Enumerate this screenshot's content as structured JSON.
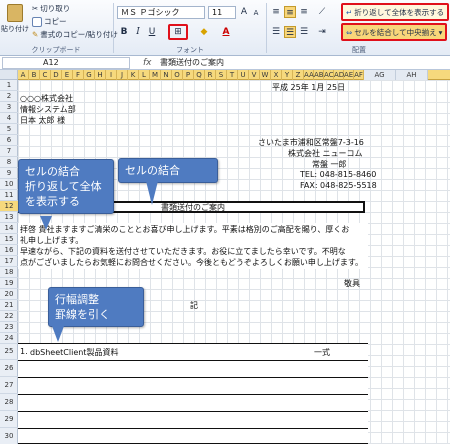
{
  "ribbon": {
    "paste_label": "貼り付け",
    "cut_label": "切り取り",
    "copy_label": "コピー",
    "format_painter_label": "書式のコピー/貼り付け",
    "clipboard_group": "クリップボード",
    "font_name": "ＭＳ Ｐゴシック",
    "font_size": "11",
    "font_group": "フォント",
    "wrap_text_label": "折り返して全体を表示する",
    "merge_center_label": "セルを結合して中央揃え",
    "alignment_group": "配置"
  },
  "formula_bar": {
    "name_box": "A12",
    "fx": "fx",
    "value": "書類送付のご案内"
  },
  "columns": [
    "A",
    "B",
    "C",
    "D",
    "E",
    "F",
    "G",
    "H",
    "I",
    "J",
    "K",
    "L",
    "M",
    "N",
    "O",
    "P",
    "Q",
    "R",
    "S",
    "T",
    "U",
    "V",
    "W",
    "X",
    "Y",
    "Z",
    "AA",
    "AB",
    "AC",
    "AD",
    "AE",
    "AF",
    "AG",
    "AH"
  ],
  "rows": [
    "1",
    "2",
    "3",
    "4",
    "5",
    "6",
    "7",
    "8",
    "9",
    "10",
    "11",
    "12",
    "13",
    "14",
    "15",
    "16",
    "17",
    "18",
    "19",
    "20",
    "21",
    "22",
    "23",
    "24",
    "25",
    "26",
    "27",
    "28",
    "29",
    "30"
  ],
  "selected_row": "12",
  "sheet": {
    "date": "平成 25年 1月 25日",
    "company": "○○○株式会社",
    "department": "情報システム部",
    "recipient": "日本 太郎 様",
    "address": "さいたま市浦和区常盤7-3-16",
    "sender_company": "株式会社 ニューコム",
    "sender_name": "常盤 一郎",
    "tel": "TEL: 048-815-8460",
    "fax": "FAX: 048-825-5518",
    "title": "書類送付のご案内",
    "body_line1": "拝啓 貴社ますますご清栄のこととお喜び申し上げます。平素は格別のご高配を賜り、厚くお",
    "body_line2": "礼申し上げます。",
    "body_line3": "早速ながら、下記の資料を送付させていただきます。お役に立てましたら幸いです。不明な",
    "body_line4": "点がございましたらお気軽にお問合せください。今後ともどうぞよろしくお願い申し上げます。",
    "closing": "敬具",
    "ki": "記",
    "item_number": "1.",
    "item_name": "dbSheetClient製品資料",
    "item_qty": "一式"
  },
  "callouts": {
    "wrap": "セルの結合\n折り返して全体\nを表示する",
    "merge": "セルの結合",
    "row_border": "行幅調整\n罫線を引く"
  },
  "colors": {
    "callout_bg": "#4f7bc1",
    "highlight_red": "#e0101b",
    "header_gold": "#f6d97d"
  }
}
